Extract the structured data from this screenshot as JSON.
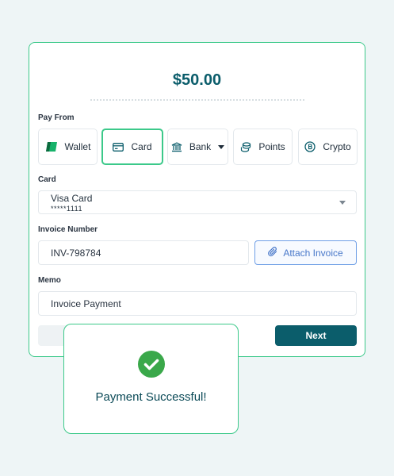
{
  "payment": {
    "amount": "$50.00",
    "pay_from_label": "Pay From",
    "methods": [
      {
        "label": "Wallet",
        "icon": "wallet-icon",
        "selected": false
      },
      {
        "label": "Card",
        "icon": "credit-card-icon",
        "selected": true
      },
      {
        "label": "Bank",
        "icon": "bank-icon",
        "selected": false,
        "has_dropdown": true
      },
      {
        "label": "Points",
        "icon": "coins-icon",
        "selected": false
      },
      {
        "label": "Crypto",
        "icon": "bitcoin-icon",
        "selected": false
      }
    ],
    "card_label": "Card",
    "card": {
      "name": "Visa Card",
      "masked_number": "*****1111"
    },
    "invoice_label": "Invoice Number",
    "invoice_value": "INV-798784",
    "attach_label": "Attach Invoice",
    "memo_label": "Memo",
    "memo_value": "Invoice Payment",
    "next_label": "Next"
  },
  "toast": {
    "message": "Payment Successful!",
    "icon": "check-circle-icon"
  },
  "colors": {
    "accent": "#0b5d6b",
    "success": "#3cc98a",
    "check": "#3aa84a",
    "link": "#4777c9"
  }
}
